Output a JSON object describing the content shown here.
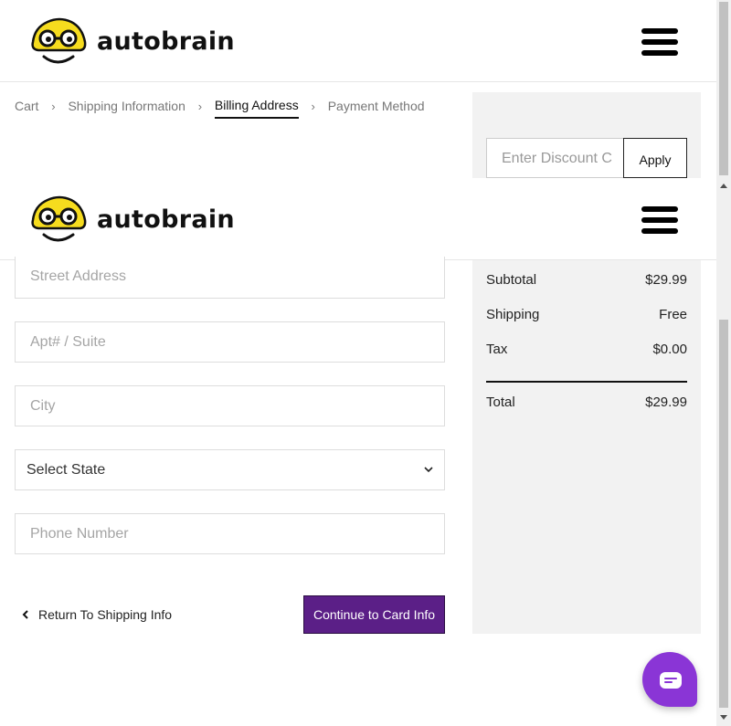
{
  "brand": {
    "name": "autobrain"
  },
  "breadcrumb": {
    "items": [
      "Cart",
      "Shipping Information",
      "Billing Address",
      "Payment Method"
    ],
    "active": "Billing Address"
  },
  "discount": {
    "placeholder": "Enter Discount C",
    "apply_label": "Apply"
  },
  "form": {
    "street_placeholder": "Street Address",
    "apt_placeholder": "Apt# / Suite",
    "city_placeholder": "City",
    "state_selected": "Select State",
    "phone_placeholder": "Phone Number"
  },
  "summary": {
    "subtotal_label": "Subtotal",
    "subtotal_value": "$29.99",
    "shipping_label": "Shipping",
    "shipping_value": "Free",
    "tax_label": "Tax",
    "tax_value": "$0.00",
    "total_label": "Total",
    "total_value": "$29.99"
  },
  "actions": {
    "back_label": "Return To Shipping Info",
    "continue_label": "Continue to Card Info"
  },
  "colors": {
    "accent": "#5b1f87",
    "chat": "#8a35d6",
    "logo_yellow": "#f6dc1e"
  },
  "icons": {
    "menu": "hamburger-icon",
    "chat": "chat-icon",
    "back": "chevron-left-icon",
    "select": "chevron-down-icon",
    "breadcrumb_sep": "chevron-right-icon"
  }
}
